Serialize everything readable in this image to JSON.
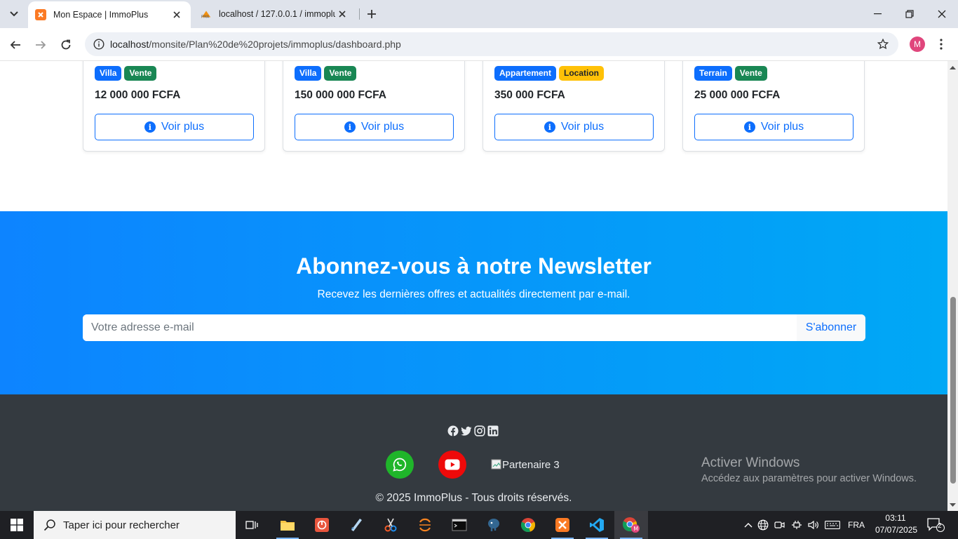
{
  "browser": {
    "tabs": [
      {
        "title": "Mon Espace | ImmoPlus",
        "active": true
      },
      {
        "title": "localhost / 127.0.0.1 / immoplus",
        "active": false
      }
    ],
    "url_host": "localhost",
    "url_path": "/monsite/Plan%20de%20projets/immoplus/dashboard.php",
    "profile_initial": "M"
  },
  "listings": [
    {
      "type": "Villa",
      "deal": "Vente",
      "price": "12 000 000 FCFA",
      "button": "Voir plus"
    },
    {
      "type": "Villa",
      "deal": "Vente",
      "price": "150 000 000 FCFA",
      "button": "Voir plus"
    },
    {
      "type": "Appartement",
      "deal": "Location",
      "price": "350 000 FCFA",
      "button": "Voir plus"
    },
    {
      "type": "Terrain",
      "deal": "Vente",
      "price": "25 000 000 FCFA",
      "button": "Voir plus"
    }
  ],
  "newsletter": {
    "title": "Abonnez-vous à notre Newsletter",
    "subtitle": "Recevez les dernières offres et actualités directement par e-mail.",
    "email_placeholder": "Votre adresse e-mail",
    "email_value": "",
    "submit_label": "S'abonner"
  },
  "footer": {
    "social_icons": [
      "facebook-icon",
      "twitter-icon",
      "instagram-icon",
      "linkedin-icon"
    ],
    "partners": [
      "whatsapp-icon",
      "youtube-icon"
    ],
    "partner3_alt": "Partenaire 3",
    "copyright": "© 2025 ImmoPlus - Tous droits réservés."
  },
  "windows_watermark": {
    "title": "Activer Windows",
    "subtitle": "Accédez aux paramètres pour activer Windows."
  },
  "taskbar": {
    "search_placeholder": "Taper ici pour rechercher",
    "language": "FRA",
    "time": "03:11",
    "date": "07/07/2025",
    "notification_count": "2"
  },
  "colors": {
    "primary": "#0d6efd",
    "success": "#198754",
    "warning": "#ffc107",
    "footer_bg": "#343a40"
  }
}
